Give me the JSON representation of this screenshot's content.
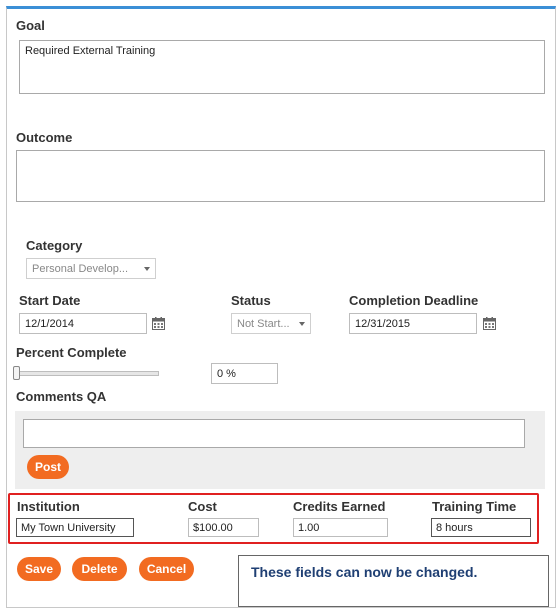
{
  "goal": {
    "label": "Goal",
    "value": "Required External Training"
  },
  "outcome": {
    "label": "Outcome",
    "value": ""
  },
  "category": {
    "label": "Category",
    "selected": "Personal Develop..."
  },
  "start_date": {
    "label": "Start Date",
    "value": "12/1/2014"
  },
  "status": {
    "label": "Status",
    "selected": "Not Start..."
  },
  "completion_deadline": {
    "label": "Completion Deadline",
    "value": "12/31/2015"
  },
  "percent_complete": {
    "label": "Percent Complete",
    "value": "0 %",
    "fraction": 0.0
  },
  "comments": {
    "label": "Comments QA",
    "value": "",
    "post_label": "Post"
  },
  "institution": {
    "label": "Institution",
    "value": "My Town University"
  },
  "cost": {
    "label": "Cost",
    "value": "$100.00"
  },
  "credits_earned": {
    "label": "Credits Earned",
    "value": "1.00"
  },
  "training_time": {
    "label": "Training Time",
    "value": "8 hours"
  },
  "actions": {
    "save_label": "Save",
    "delete_label": "Delete",
    "cancel_label": "Cancel"
  },
  "note": {
    "text": "These fields can now be changed."
  },
  "colors": {
    "accent": "#f26b21",
    "highlight": "#e02020",
    "top_border": "#3b8fd6",
    "note_text": "#1f3f73"
  },
  "icons": [
    "calendar-icon",
    "chevron-down-icon",
    "slider-handle"
  ]
}
